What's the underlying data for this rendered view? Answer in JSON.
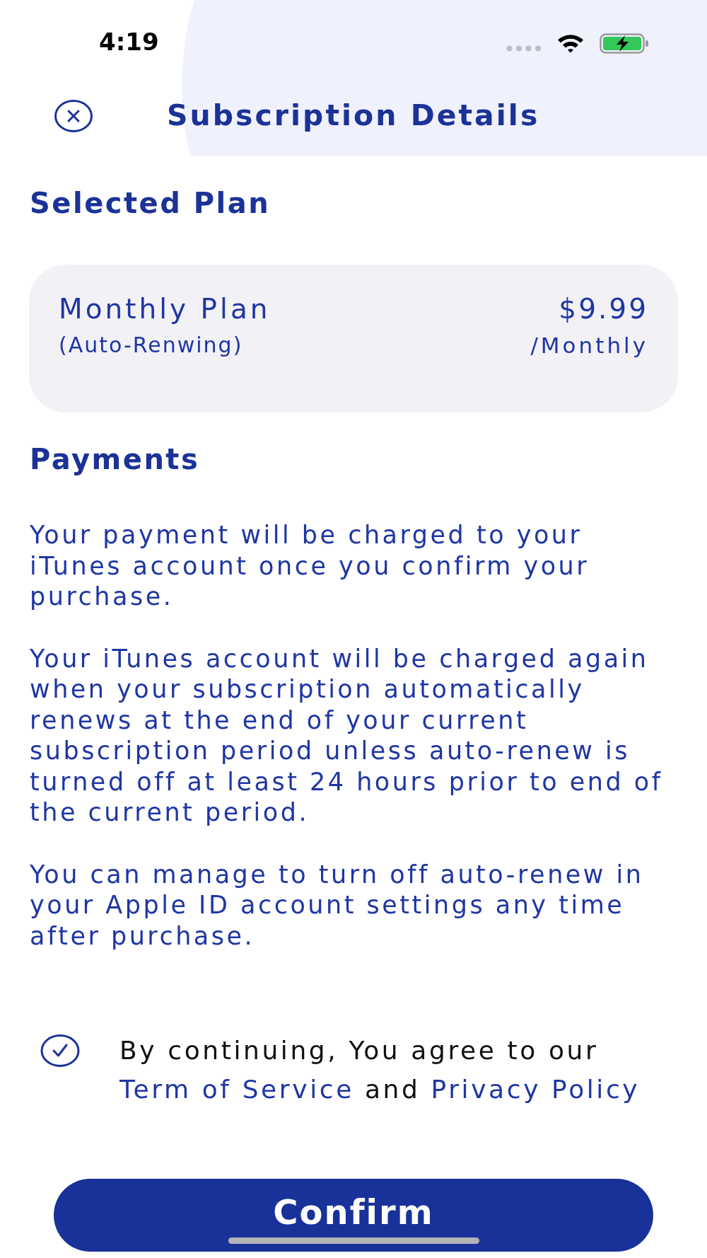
{
  "status_bar": {
    "time": "4:19"
  },
  "header": {
    "title": "Subscription Details"
  },
  "selected_plan": {
    "heading": "Selected Plan",
    "plan": {
      "name": "Monthly Plan",
      "note": "(Auto-Renwing)",
      "price": "$9.99",
      "period": "/Monthly"
    }
  },
  "payments": {
    "heading": "Payments",
    "paragraphs": [
      "Your payment will be charged to your iTunes account once you confirm your purchase.",
      "Your iTunes account will be charged again when your subscription automatically renews at the end of your current subscription period unless auto-renew is turned off at least 24 hours prior to end of the current period.",
      "You can manage to turn off auto-renew in your Apple ID account settings any time after purchase."
    ]
  },
  "agreement": {
    "checked": true,
    "text": "By continuing, You agree to our",
    "terms_link": "Term of Service",
    "joiner": "and",
    "privacy_link": "Privacy Policy"
  },
  "confirm_button": {
    "label": "Confirm"
  }
}
